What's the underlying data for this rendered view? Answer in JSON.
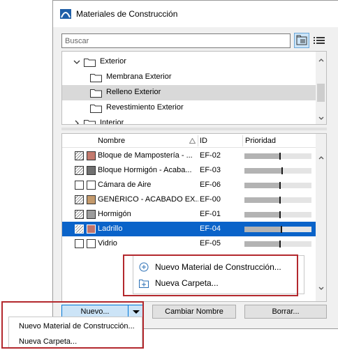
{
  "window": {
    "title": "Materiales de Construcción"
  },
  "search": {
    "placeholder": "Buscar"
  },
  "tree": {
    "items": [
      {
        "label": "Exterior"
      },
      {
        "label": "Membrana Exterior"
      },
      {
        "label": "Relleno Exterior"
      },
      {
        "label": "Revestimiento Exterior"
      },
      {
        "label": "Interior"
      }
    ]
  },
  "list": {
    "columns": {
      "name": "Nombre",
      "id": "ID",
      "priority": "Prioridad"
    },
    "rows": [
      {
        "name": "Bloque de Mampostería - ...",
        "id": "EF-02",
        "priority": 0.52,
        "color": "#c47a6e"
      },
      {
        "name": "Bloque Hormigón - Acaba...",
        "id": "EF-03",
        "priority": 0.55,
        "color": "#707070"
      },
      {
        "name": "Cámara de Aire",
        "id": "EF-06",
        "priority": 0.52,
        "color": "#ffffff"
      },
      {
        "name": "GENÉRICO - ACABADO EX...",
        "id": "EF-00",
        "priority": 0.52,
        "color": "#c49a6c"
      },
      {
        "name": "Hormigón",
        "id": "EF-01",
        "priority": 0.52,
        "color": "#9c9c9c"
      },
      {
        "name": "Ladrillo",
        "id": "EF-04",
        "priority": 0.54,
        "color": "#c0736a"
      },
      {
        "name": "Vidrio",
        "id": "EF-05",
        "priority": 0.52,
        "color": "#ffffff"
      }
    ]
  },
  "popup": {
    "new_material": "Nuevo Material de Construcción...",
    "new_folder": "Nueva Carpeta..."
  },
  "buttons": {
    "new": "Nuevo...",
    "rename": "Cambiar Nombre",
    "delete": "Borrar..."
  },
  "dropdown": {
    "new_material": "Nuevo Material de Construcción...",
    "new_folder": "Nueva Carpeta..."
  },
  "colors": {
    "accent": "#0a63c9",
    "highlight_box": "#b3282d"
  }
}
